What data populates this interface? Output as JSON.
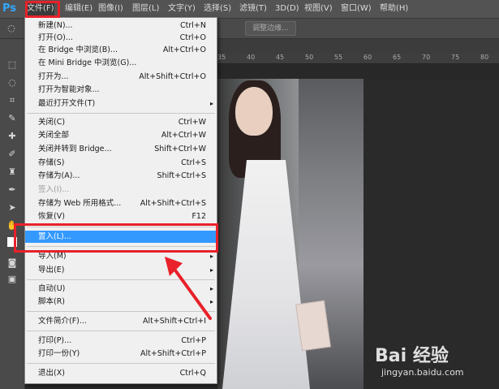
{
  "app": {
    "logo": "Ps"
  },
  "menubar": {
    "items": [
      "文件(F)",
      "编辑(E)",
      "图像(I)",
      "图层(L)",
      "文字(Y)",
      "选择(S)",
      "滤镜(T)",
      "3D(D)",
      "视图(V)",
      "窗口(W)",
      "帮助(H)"
    ]
  },
  "options_bar": {
    "button_label": "调整边缘..."
  },
  "ruler": {
    "ticks": [
      "35",
      "40",
      "45",
      "50",
      "55",
      "60",
      "65",
      "70",
      "75",
      "80"
    ]
  },
  "file_menu": {
    "items": [
      {
        "label": "新建(N)...",
        "shortcut": "Ctrl+N"
      },
      {
        "label": "打开(O)...",
        "shortcut": "Ctrl+O"
      },
      {
        "label": "在 Bridge 中浏览(B)...",
        "shortcut": "Alt+Ctrl+O"
      },
      {
        "label": "在 Mini Bridge 中浏览(G)...",
        "shortcut": ""
      },
      {
        "label": "打开为...",
        "shortcut": "Alt+Shift+Ctrl+O"
      },
      {
        "label": "打开为智能对象...",
        "shortcut": ""
      },
      {
        "label": "最近打开文件(T)",
        "shortcut": "",
        "submenu": true
      },
      {
        "label": "关闭(C)",
        "shortcut": "Ctrl+W"
      },
      {
        "label": "关闭全部",
        "shortcut": "Alt+Ctrl+W"
      },
      {
        "label": "关闭并转到 Bridge...",
        "shortcut": "Shift+Ctrl+W"
      },
      {
        "label": "存储(S)",
        "shortcut": "Ctrl+S"
      },
      {
        "label": "存储为(A)...",
        "shortcut": "Shift+Ctrl+S"
      },
      {
        "label": "签入(I)...",
        "shortcut": "",
        "disabled": true
      },
      {
        "label": "存储为 Web 所用格式...",
        "shortcut": "Alt+Shift+Ctrl+S"
      },
      {
        "label": "恢复(V)",
        "shortcut": "F12"
      },
      {
        "label": "置入(L)...",
        "shortcut": "",
        "highlighted": true
      },
      {
        "label": "导入(M)",
        "shortcut": "",
        "submenu": true
      },
      {
        "label": "导出(E)",
        "shortcut": "",
        "submenu": true
      },
      {
        "label": "自动(U)",
        "shortcut": "",
        "submenu": true
      },
      {
        "label": "脚本(R)",
        "shortcut": "",
        "submenu": true
      },
      {
        "label": "文件简介(F)...",
        "shortcut": "Alt+Shift+Ctrl+I"
      },
      {
        "label": "打印(P)...",
        "shortcut": "Ctrl+P"
      },
      {
        "label": "打印一份(Y)",
        "shortcut": "Alt+Shift+Ctrl+P"
      },
      {
        "label": "退出(X)",
        "shortcut": "Ctrl+Q"
      }
    ],
    "submenu_glyph": "▸"
  },
  "watermark": {
    "logo": "Bai 经验",
    "url": "jingyan.baidu.com"
  },
  "colors": {
    "highlight": "#3399ff",
    "annotation": "#e8212a"
  }
}
